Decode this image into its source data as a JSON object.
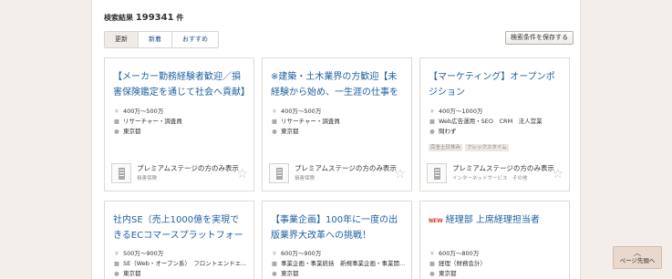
{
  "results": {
    "prefix": "検索結果",
    "count": "199341",
    "suffix": "件"
  },
  "sort_tabs": [
    {
      "label": "更新"
    },
    {
      "label": "新着"
    },
    {
      "label": "おすすめ"
    }
  ],
  "save_button": "検索条件を保存する",
  "cards": [
    {
      "title": "【メーカー勤務経験者歓迎／損害保険鑑定を通じて社会へ貢献】",
      "salary": "400万～500万",
      "job_type": "リサーチャー・調査員",
      "location": "東京都",
      "company_name": "プレミアムステージの方のみ表示",
      "company_industry": "損害保険"
    },
    {
      "title": "※建築・土木業界の方歓迎【未経験から始め、一生涯の仕事を手に",
      "salary": "400万～500万",
      "job_type": "リサーチャー・調査員",
      "location": "東京都",
      "company_name": "プレミアムステージの方のみ表示",
      "company_industry": "損害保険"
    },
    {
      "title": "【マーケティング】オープンポジション",
      "salary": "400万～1000万",
      "job_type": "Web広告運用・SEO　CRM　法人営業",
      "location": "問わず",
      "tags": [
        "完全土日休み",
        "フレックスタイム"
      ],
      "company_name": "プレミアムステージの方のみ表示",
      "company_industry": "インターネットサービス　その他"
    },
    {
      "title": "社内SE（売上1000億を実現できるECコマースプラットフォームへ",
      "salary": "500万～900万",
      "job_type": "SE（Web・オープン系）　フロントエンドエ...",
      "location": "東京都"
    },
    {
      "title": "【事業企画】100年に一度の出版業界大改革への挑戦！",
      "salary": "600万～900万",
      "job_type": "事業企画・事業統括　新規事業企画・事業開...",
      "location": "東京都"
    },
    {
      "new_badge": "NEW",
      "title": "経理部 上席経理担当者",
      "salary": "600万～800万",
      "job_type": "経理（財務会計）",
      "location": "東京都"
    }
  ],
  "icons": {
    "salary": "yen-icon",
    "job_type": "briefcase-icon",
    "location": "location-pin-icon",
    "favorite": "star-outline-icon",
    "company_logo": "building-icon",
    "page_top": "chevron-up-icon"
  },
  "colors": {
    "link": "#1d5f9e",
    "new_badge": "#d63a2f",
    "background": "#f3eeea",
    "page_top_button": "#e8d9cc"
  },
  "page_top": {
    "arrow": "︿",
    "label": "ページ先頭へ"
  }
}
